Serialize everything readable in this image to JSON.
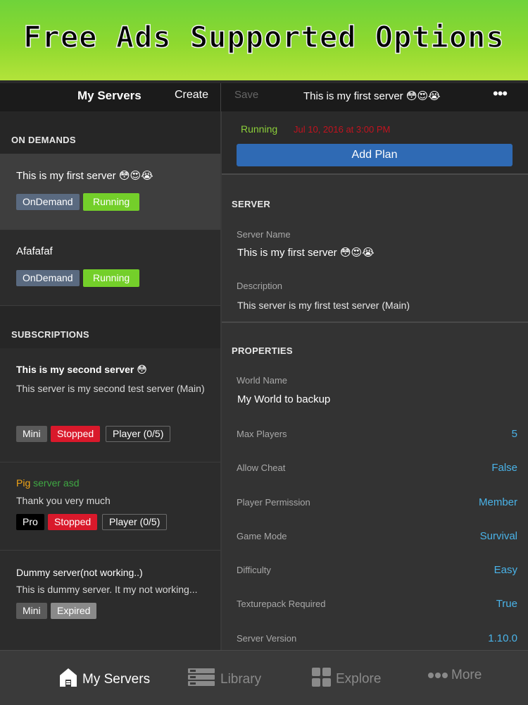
{
  "banner": {
    "text": "Free Ads Supported Options"
  },
  "nav": {
    "title": "My Servers",
    "create": "Create",
    "save": "Save",
    "server_title": "This is my first server 😳😍😭",
    "more": "•••"
  },
  "left": {
    "on_demands_header": "ON DEMANDS",
    "subscriptions_header": "SUBSCRIPTIONS",
    "on_demand_items": [
      {
        "title": "This is my first server  😳😍😭",
        "tags": [
          "OnDemand",
          "Running"
        ]
      },
      {
        "title": "Afafafaf",
        "tags": [
          "OnDemand",
          "Running"
        ]
      }
    ],
    "subscriptions": [
      {
        "title": "This is my second server 😳",
        "desc": "This server is my second test server (Main)",
        "tags": [
          "Mini",
          "Stopped",
          "Player (0/5)"
        ]
      },
      {
        "title_part1": "Pig",
        "title_part2": " server asd",
        "desc": "Thank you very much",
        "tags": [
          "Pro",
          "Stopped",
          "Player (0/5)"
        ]
      },
      {
        "title": "Dummy server(not working..)",
        "desc": "This is dummy server. It my not working...",
        "tags": [
          "Mini",
          "Expired"
        ]
      }
    ]
  },
  "right": {
    "status": "Running",
    "status_date": "Jul 10, 2016 at 3:00 PM",
    "add_plan": "Add Plan",
    "server_header": "SERVER",
    "server_name_label": "Server Name",
    "server_name": "This is my first server  😳😍😭",
    "description_label": "Description",
    "description": "This server is my first test server (Main)",
    "properties_header": "PROPERTIES",
    "world_name_label": "World Name",
    "world_name": "My World to backup",
    "properties": [
      {
        "label": "Max Players",
        "value": "5"
      },
      {
        "label": "Allow Cheat",
        "value": "False"
      },
      {
        "label": "Player Permission",
        "value": "Member"
      },
      {
        "label": "Game Mode",
        "value": "Survival"
      },
      {
        "label": "Difficulty",
        "value": "Easy"
      },
      {
        "label": "Texturepack Required",
        "value": "True"
      },
      {
        "label": "Server Version",
        "value": "1.10.0"
      }
    ]
  },
  "tabs": [
    {
      "label": "My Servers",
      "icon": "house-icon",
      "active": true
    },
    {
      "label": "Library",
      "icon": "stack-icon",
      "active": false
    },
    {
      "label": "Explore",
      "icon": "grid-icon",
      "active": false
    },
    {
      "label": "More",
      "icon": "dots-icon",
      "active": false
    }
  ],
  "colors": {
    "running": "#74cf2a",
    "stopped": "#d9192b",
    "accent_blue": "#4ab3e8",
    "button_blue": "#2f6ab4",
    "banner_green": "#8fd92f"
  }
}
